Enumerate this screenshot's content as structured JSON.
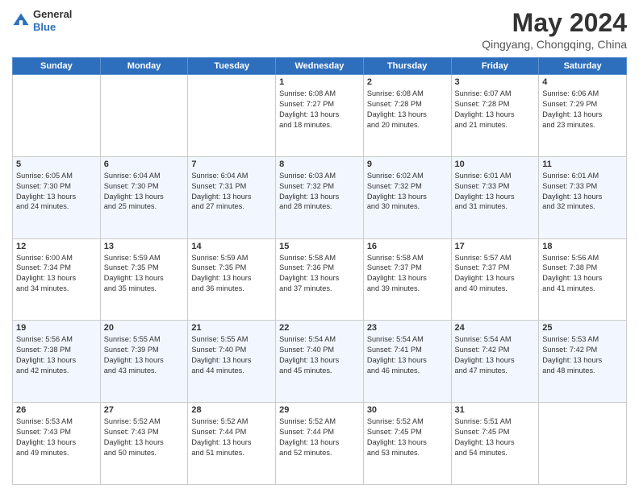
{
  "header": {
    "logo_general": "General",
    "logo_blue": "Blue",
    "title": "May 2024",
    "location": "Qingyang, Chongqing, China"
  },
  "days_of_week": [
    "Sunday",
    "Monday",
    "Tuesday",
    "Wednesday",
    "Thursday",
    "Friday",
    "Saturday"
  ],
  "weeks": [
    [
      {
        "day": "",
        "info": ""
      },
      {
        "day": "",
        "info": ""
      },
      {
        "day": "",
        "info": ""
      },
      {
        "day": "1",
        "info": "Sunrise: 6:08 AM\nSunset: 7:27 PM\nDaylight: 13 hours\nand 18 minutes."
      },
      {
        "day": "2",
        "info": "Sunrise: 6:08 AM\nSunset: 7:28 PM\nDaylight: 13 hours\nand 20 minutes."
      },
      {
        "day": "3",
        "info": "Sunrise: 6:07 AM\nSunset: 7:28 PM\nDaylight: 13 hours\nand 21 minutes."
      },
      {
        "day": "4",
        "info": "Sunrise: 6:06 AM\nSunset: 7:29 PM\nDaylight: 13 hours\nand 23 minutes."
      }
    ],
    [
      {
        "day": "5",
        "info": "Sunrise: 6:05 AM\nSunset: 7:30 PM\nDaylight: 13 hours\nand 24 minutes."
      },
      {
        "day": "6",
        "info": "Sunrise: 6:04 AM\nSunset: 7:30 PM\nDaylight: 13 hours\nand 25 minutes."
      },
      {
        "day": "7",
        "info": "Sunrise: 6:04 AM\nSunset: 7:31 PM\nDaylight: 13 hours\nand 27 minutes."
      },
      {
        "day": "8",
        "info": "Sunrise: 6:03 AM\nSunset: 7:32 PM\nDaylight: 13 hours\nand 28 minutes."
      },
      {
        "day": "9",
        "info": "Sunrise: 6:02 AM\nSunset: 7:32 PM\nDaylight: 13 hours\nand 30 minutes."
      },
      {
        "day": "10",
        "info": "Sunrise: 6:01 AM\nSunset: 7:33 PM\nDaylight: 13 hours\nand 31 minutes."
      },
      {
        "day": "11",
        "info": "Sunrise: 6:01 AM\nSunset: 7:33 PM\nDaylight: 13 hours\nand 32 minutes."
      }
    ],
    [
      {
        "day": "12",
        "info": "Sunrise: 6:00 AM\nSunset: 7:34 PM\nDaylight: 13 hours\nand 34 minutes."
      },
      {
        "day": "13",
        "info": "Sunrise: 5:59 AM\nSunset: 7:35 PM\nDaylight: 13 hours\nand 35 minutes."
      },
      {
        "day": "14",
        "info": "Sunrise: 5:59 AM\nSunset: 7:35 PM\nDaylight: 13 hours\nand 36 minutes."
      },
      {
        "day": "15",
        "info": "Sunrise: 5:58 AM\nSunset: 7:36 PM\nDaylight: 13 hours\nand 37 minutes."
      },
      {
        "day": "16",
        "info": "Sunrise: 5:58 AM\nSunset: 7:37 PM\nDaylight: 13 hours\nand 39 minutes."
      },
      {
        "day": "17",
        "info": "Sunrise: 5:57 AM\nSunset: 7:37 PM\nDaylight: 13 hours\nand 40 minutes."
      },
      {
        "day": "18",
        "info": "Sunrise: 5:56 AM\nSunset: 7:38 PM\nDaylight: 13 hours\nand 41 minutes."
      }
    ],
    [
      {
        "day": "19",
        "info": "Sunrise: 5:56 AM\nSunset: 7:38 PM\nDaylight: 13 hours\nand 42 minutes."
      },
      {
        "day": "20",
        "info": "Sunrise: 5:55 AM\nSunset: 7:39 PM\nDaylight: 13 hours\nand 43 minutes."
      },
      {
        "day": "21",
        "info": "Sunrise: 5:55 AM\nSunset: 7:40 PM\nDaylight: 13 hours\nand 44 minutes."
      },
      {
        "day": "22",
        "info": "Sunrise: 5:54 AM\nSunset: 7:40 PM\nDaylight: 13 hours\nand 45 minutes."
      },
      {
        "day": "23",
        "info": "Sunrise: 5:54 AM\nSunset: 7:41 PM\nDaylight: 13 hours\nand 46 minutes."
      },
      {
        "day": "24",
        "info": "Sunrise: 5:54 AM\nSunset: 7:42 PM\nDaylight: 13 hours\nand 47 minutes."
      },
      {
        "day": "25",
        "info": "Sunrise: 5:53 AM\nSunset: 7:42 PM\nDaylight: 13 hours\nand 48 minutes."
      }
    ],
    [
      {
        "day": "26",
        "info": "Sunrise: 5:53 AM\nSunset: 7:43 PM\nDaylight: 13 hours\nand 49 minutes."
      },
      {
        "day": "27",
        "info": "Sunrise: 5:52 AM\nSunset: 7:43 PM\nDaylight: 13 hours\nand 50 minutes."
      },
      {
        "day": "28",
        "info": "Sunrise: 5:52 AM\nSunset: 7:44 PM\nDaylight: 13 hours\nand 51 minutes."
      },
      {
        "day": "29",
        "info": "Sunrise: 5:52 AM\nSunset: 7:44 PM\nDaylight: 13 hours\nand 52 minutes."
      },
      {
        "day": "30",
        "info": "Sunrise: 5:52 AM\nSunset: 7:45 PM\nDaylight: 13 hours\nand 53 minutes."
      },
      {
        "day": "31",
        "info": "Sunrise: 5:51 AM\nSunset: 7:45 PM\nDaylight: 13 hours\nand 54 minutes."
      },
      {
        "day": "",
        "info": ""
      }
    ]
  ]
}
